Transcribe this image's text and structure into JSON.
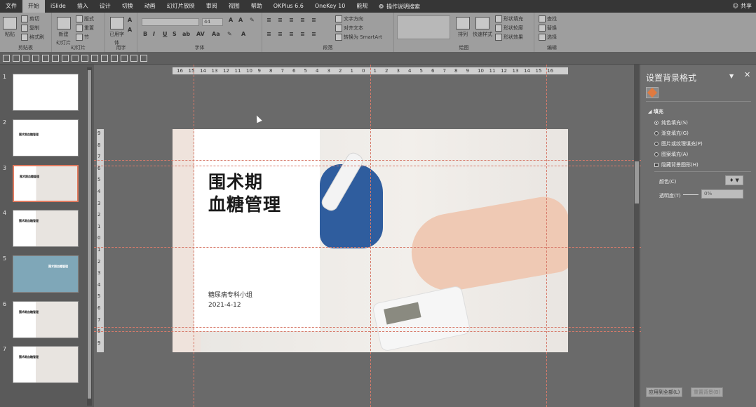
{
  "menubar": {
    "tabs": [
      "文件",
      "开始",
      "iSlide",
      "插入",
      "设计",
      "切换",
      "动画",
      "幻灯片放映",
      "审阅",
      "视图",
      "帮助",
      "OKPlus 6.6",
      "OneKey 10",
      "能规"
    ],
    "active_tab": "开始",
    "search": "操作说明搜索",
    "share": "共享"
  },
  "ribbon": {
    "clipboard": {
      "label": "剪贴板",
      "paste": "粘贴",
      "cut": "剪切",
      "copy": "复制",
      "format_painter": "格式刷"
    },
    "slides": {
      "label": "幻灯片",
      "new_slide": "新建",
      "new_slide2": "幻灯片",
      "layout": "版式",
      "reset": "重置",
      "section": "节"
    },
    "common_font": {
      "label": "用字",
      "name": "已用字",
      "name2": "体"
    },
    "font": {
      "label": "字体",
      "size": "44"
    },
    "paragraph": {
      "label": "段落",
      "text_direction": "文字方向",
      "align_text": "对齐文本",
      "smartart": "转换为 SmartArt"
    },
    "drawing": {
      "label": "绘图",
      "arrange": "排列",
      "quick_styles": "快速样式",
      "shape_fill": "形状填充",
      "shape_outline": "形状轮廓",
      "shape_effects": "形状效果"
    },
    "editing": {
      "label": "编辑",
      "find": "查找",
      "replace": "替换",
      "select": "选择"
    }
  },
  "thumbnails": {
    "items": [
      {
        "num": "1",
        "title": ""
      },
      {
        "num": "2",
        "title": "围术期血糖管理"
      },
      {
        "num": "3",
        "title": "围术期血糖管理"
      },
      {
        "num": "4",
        "title": "围术期血糖管理"
      },
      {
        "num": "5",
        "title": "围术期血糖管理"
      },
      {
        "num": "6",
        "title": "围术期血糖管理"
      },
      {
        "num": "7",
        "title": "围术期血糖管理"
      }
    ],
    "active_index": 2
  },
  "ruler": {
    "h": [
      "16",
      "15",
      "14",
      "13",
      "12",
      "11",
      "10",
      "9",
      "8",
      "7",
      "6",
      "5",
      "4",
      "3",
      "2",
      "1",
      "0",
      "1",
      "2",
      "3",
      "4",
      "5",
      "6",
      "7",
      "8",
      "9",
      "10",
      "11",
      "12",
      "13",
      "14",
      "15",
      "16"
    ],
    "v": [
      "9",
      "8",
      "7",
      "6",
      "5",
      "4",
      "3",
      "2",
      "1",
      "0",
      "1",
      "2",
      "3",
      "4",
      "5",
      "6",
      "7",
      "8",
      "9"
    ]
  },
  "slide": {
    "title_line1": "围术期",
    "title_line2": "血糖管理",
    "subtitle_line1": "糖尿病专科小组",
    "subtitle_line2": "2021-4-12"
  },
  "pane": {
    "title": "设置背景格式",
    "section": "填充",
    "options": [
      {
        "label": "纯色填充(S)",
        "type": "radio",
        "checked": true
      },
      {
        "label": "渐变填充(G)",
        "type": "radio",
        "checked": false
      },
      {
        "label": "图片或纹理填充(P)",
        "type": "radio",
        "checked": false
      },
      {
        "label": "图案填充(A)",
        "type": "radio",
        "checked": false
      },
      {
        "label": "隐藏背景图形(H)",
        "type": "checkbox",
        "checked": false
      }
    ],
    "color_label": "颜色(C)",
    "transparency_label": "透明度(T)",
    "transparency_value": "0%",
    "apply_all": "应用到全部(L)",
    "reset_bg": "重置背景(B)"
  }
}
